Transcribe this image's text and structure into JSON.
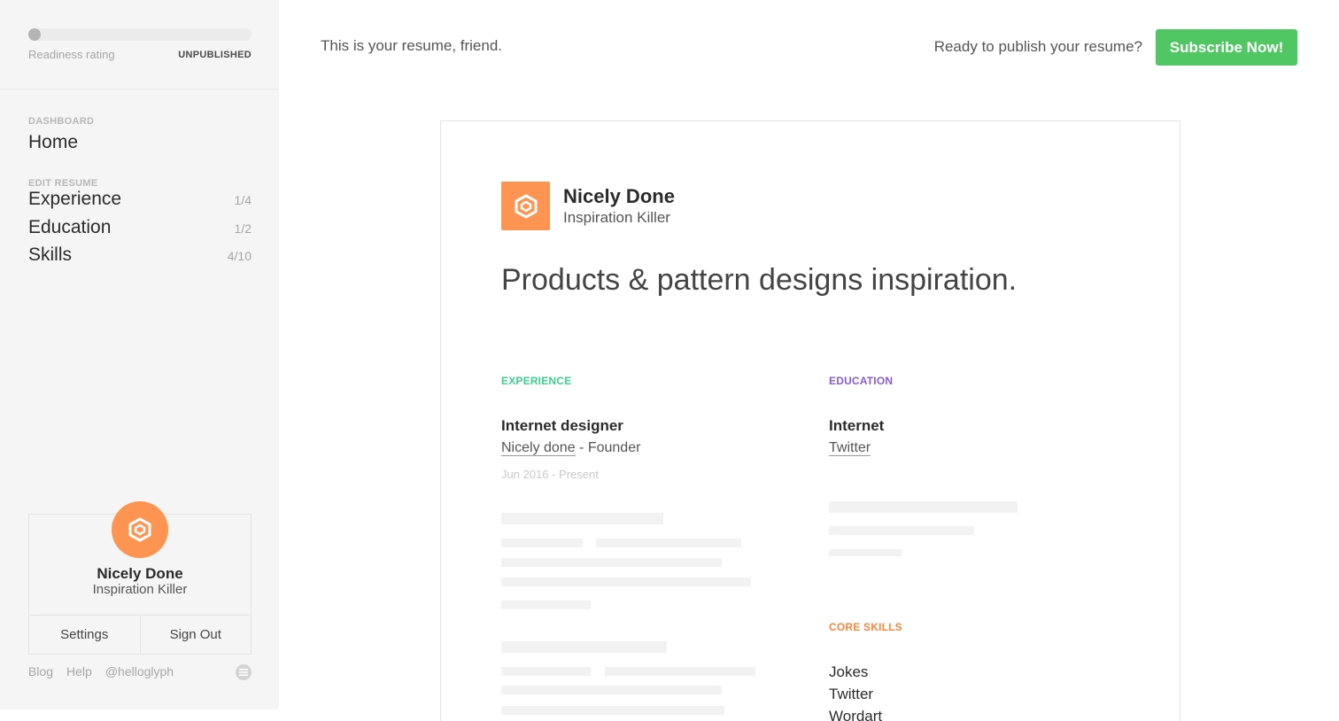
{
  "sidebar": {
    "readiness": {
      "label": "Readiness rating",
      "status": "UNPUBLISHED",
      "progress": 0.05
    },
    "dashboard_label": "DASHBOARD",
    "home_label": "Home",
    "edit_label": "EDIT RESUME",
    "items": [
      {
        "label": "Experience",
        "count": "1/4"
      },
      {
        "label": "Education",
        "count": "1/2"
      },
      {
        "label": "Skills",
        "count": "4/10"
      }
    ],
    "profile": {
      "name": "Nicely Done",
      "title": "Inspiration Killer",
      "settings_label": "Settings",
      "signout_label": "Sign Out"
    },
    "footer": {
      "blog": "Blog",
      "help": "Help",
      "handle": "@helloglyph"
    }
  },
  "topbar": {
    "intro": "This is your resume, friend.",
    "publish_prompt": "Ready to publish your resume?",
    "subscribe_label": "Subscribe Now!"
  },
  "resume": {
    "name": "Nicely Done",
    "title": "Inspiration Killer",
    "headline": "Products & pattern designs inspiration.",
    "experience": {
      "label": "EXPERIENCE",
      "role": "Internet designer",
      "company": "Nicely done",
      "position": " - Founder",
      "dates": "Jun 2016 - Present"
    },
    "education": {
      "label": "EDUCATION",
      "school": "Internet",
      "program": "Twitter"
    },
    "skills": {
      "label": "CORE SKILLS",
      "items": [
        "Jokes",
        "Twitter",
        "Wordart"
      ]
    }
  },
  "colors": {
    "accent_orange": "#fd9451",
    "subscribe_green": "#51c763",
    "experience_green": "#3ecf8e",
    "education_purple": "#8a5cd6",
    "skills_orange": "#f5883f"
  },
  "icons": {
    "logo": "hexagon-logo-icon",
    "chat": "chat-icon"
  }
}
